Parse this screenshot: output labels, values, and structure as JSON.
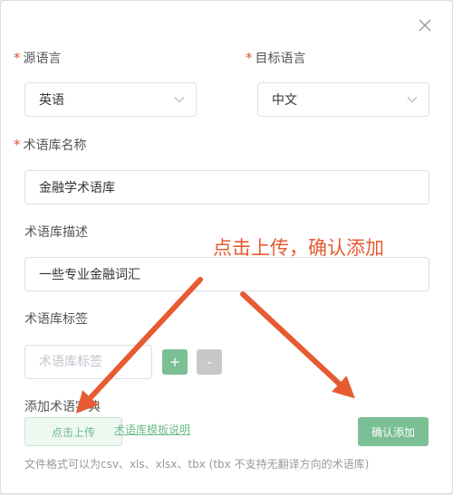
{
  "dialog": {
    "source_language": {
      "label": "源语言",
      "value": "英语"
    },
    "target_language": {
      "label": "目标语言",
      "value": "中文"
    },
    "termbase_name": {
      "label": "术语库名称",
      "value": "金融学术语库"
    },
    "termbase_description": {
      "label": "术语库描述",
      "value": "一些专业金融词汇"
    },
    "termbase_tags": {
      "label": "术语库标签",
      "placeholder": "术语库标签",
      "add_label": "+",
      "remove_label": "-"
    },
    "add_dictionary": {
      "label": "添加术语字典",
      "upload_label": "点击上传",
      "template_link": "术语库模板说明",
      "format_hint": "文件格式可以为csv、xls、xlsx、tbx (tbx 不支持无翻译方向的术语库)"
    },
    "required_mark": "*",
    "confirm_label": "确认添加"
  },
  "annotation": {
    "text": "点击上传，确认添加"
  },
  "colors": {
    "accent_green": "#7bbf94",
    "annotation_orange": "#e65b32",
    "required_red": "#e0533f"
  }
}
